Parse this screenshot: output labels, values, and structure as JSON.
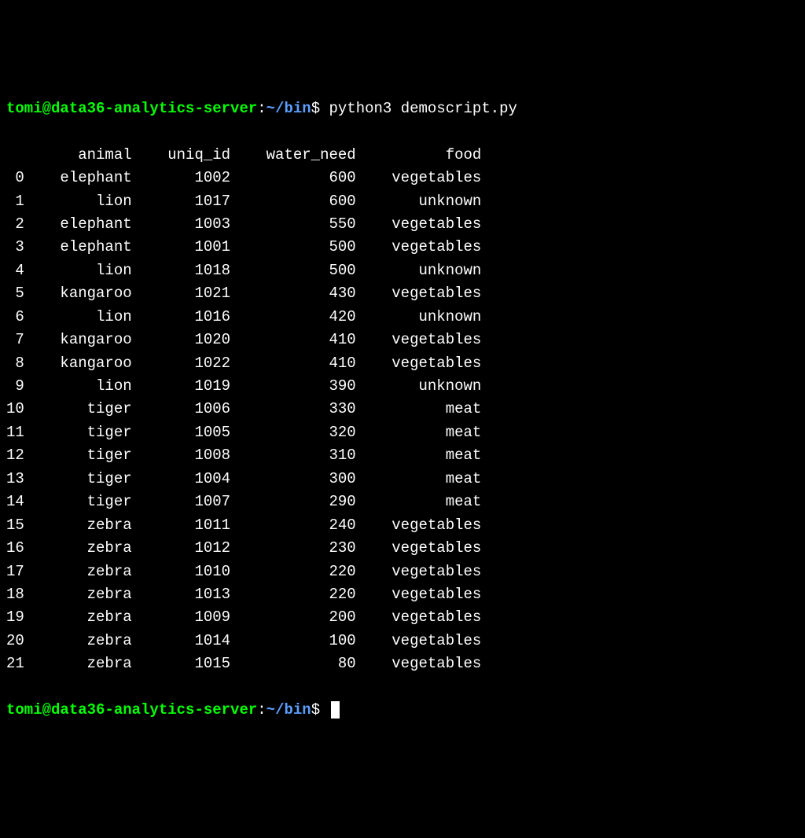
{
  "prompt": {
    "user": "tomi@data36-analytics-server",
    "colon": ":",
    "path": "~/bin",
    "dollar": "$",
    "command": "python3 demoscript.py"
  },
  "table": {
    "headers": [
      "animal",
      "uniq_id",
      "water_need",
      "food"
    ],
    "rows": [
      {
        "idx": "0",
        "animal": "elephant",
        "uniq_id": "1002",
        "water_need": "600",
        "food": "vegetables"
      },
      {
        "idx": "1",
        "animal": "lion",
        "uniq_id": "1017",
        "water_need": "600",
        "food": "unknown"
      },
      {
        "idx": "2",
        "animal": "elephant",
        "uniq_id": "1003",
        "water_need": "550",
        "food": "vegetables"
      },
      {
        "idx": "3",
        "animal": "elephant",
        "uniq_id": "1001",
        "water_need": "500",
        "food": "vegetables"
      },
      {
        "idx": "4",
        "animal": "lion",
        "uniq_id": "1018",
        "water_need": "500",
        "food": "unknown"
      },
      {
        "idx": "5",
        "animal": "kangaroo",
        "uniq_id": "1021",
        "water_need": "430",
        "food": "vegetables"
      },
      {
        "idx": "6",
        "animal": "lion",
        "uniq_id": "1016",
        "water_need": "420",
        "food": "unknown"
      },
      {
        "idx": "7",
        "animal": "kangaroo",
        "uniq_id": "1020",
        "water_need": "410",
        "food": "vegetables"
      },
      {
        "idx": "8",
        "animal": "kangaroo",
        "uniq_id": "1022",
        "water_need": "410",
        "food": "vegetables"
      },
      {
        "idx": "9",
        "animal": "lion",
        "uniq_id": "1019",
        "water_need": "390",
        "food": "unknown"
      },
      {
        "idx": "10",
        "animal": "tiger",
        "uniq_id": "1006",
        "water_need": "330",
        "food": "meat"
      },
      {
        "idx": "11",
        "animal": "tiger",
        "uniq_id": "1005",
        "water_need": "320",
        "food": "meat"
      },
      {
        "idx": "12",
        "animal": "tiger",
        "uniq_id": "1008",
        "water_need": "310",
        "food": "meat"
      },
      {
        "idx": "13",
        "animal": "tiger",
        "uniq_id": "1004",
        "water_need": "300",
        "food": "meat"
      },
      {
        "idx": "14",
        "animal": "tiger",
        "uniq_id": "1007",
        "water_need": "290",
        "food": "meat"
      },
      {
        "idx": "15",
        "animal": "zebra",
        "uniq_id": "1011",
        "water_need": "240",
        "food": "vegetables"
      },
      {
        "idx": "16",
        "animal": "zebra",
        "uniq_id": "1012",
        "water_need": "230",
        "food": "vegetables"
      },
      {
        "idx": "17",
        "animal": "zebra",
        "uniq_id": "1010",
        "water_need": "220",
        "food": "vegetables"
      },
      {
        "idx": "18",
        "animal": "zebra",
        "uniq_id": "1013",
        "water_need": "220",
        "food": "vegetables"
      },
      {
        "idx": "19",
        "animal": "zebra",
        "uniq_id": "1009",
        "water_need": "200",
        "food": "vegetables"
      },
      {
        "idx": "20",
        "animal": "zebra",
        "uniq_id": "1014",
        "water_need": "100",
        "food": "vegetables"
      },
      {
        "idx": "21",
        "animal": "zebra",
        "uniq_id": "1015",
        "water_need": "80",
        "food": "vegetables"
      }
    ]
  },
  "widths": {
    "idx": 2,
    "animal": 10,
    "uniq_id": 9,
    "water_need": 12,
    "food": 12
  }
}
